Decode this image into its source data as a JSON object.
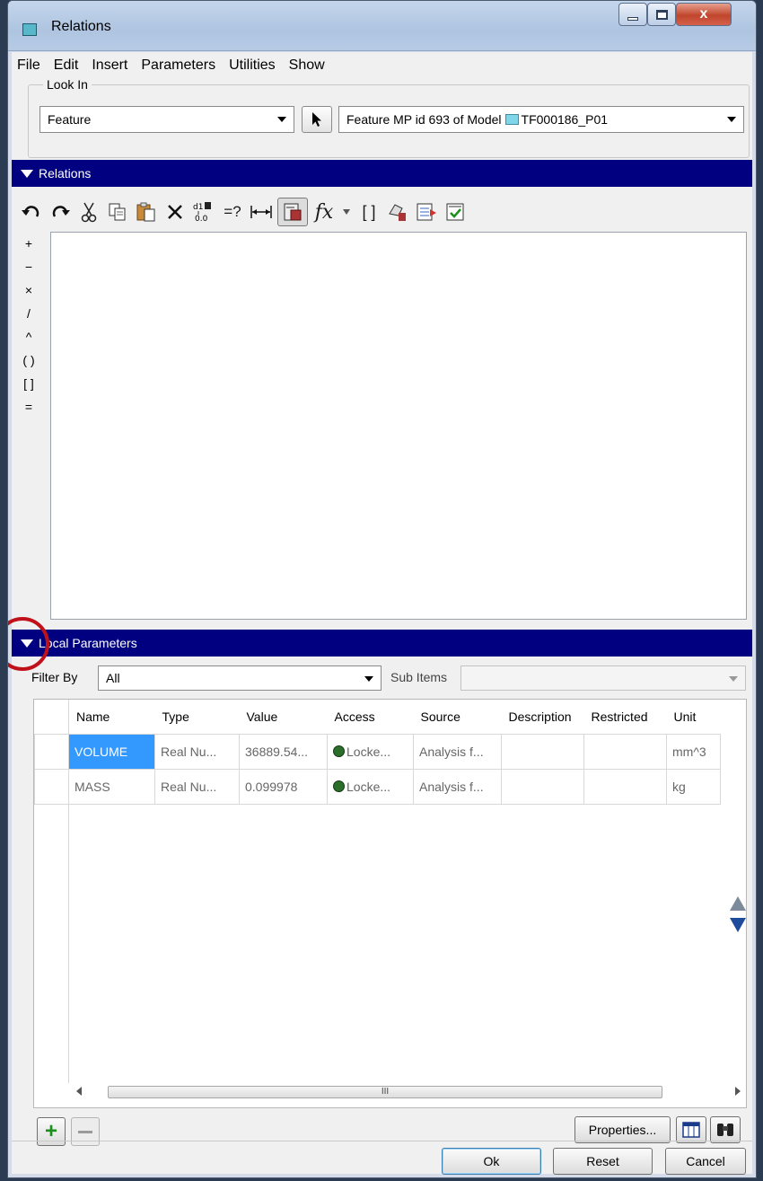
{
  "window": {
    "title": "Relations",
    "close_glyph": "x"
  },
  "menu": [
    "File",
    "Edit",
    "Insert",
    "Parameters",
    "Utilities",
    "Show"
  ],
  "look_in": {
    "legend": "Look In",
    "type_value": "Feature",
    "target_value": "Feature MP id 693 of Model",
    "model_name": "TF000186_P01"
  },
  "relations_section": {
    "title": "Relations"
  },
  "toolbar_icons": [
    "undo-icon",
    "redo-icon",
    "cut-icon",
    "copy-icon",
    "paste-icon",
    "delete-icon",
    "switch-dims-icon",
    "evaluate-icon",
    "insert-dimension-icon",
    "display-values-icon",
    "function-icon",
    "brackets-icon",
    "sort-icon",
    "verify-icon",
    "check-icon"
  ],
  "toolbar_text": {
    "fx": "fx",
    "evaluate": "=?",
    "brackets": "[ ]",
    "d1": "d1",
    "zero": "0.0"
  },
  "operators": [
    "+",
    "−",
    "×",
    "/",
    "^",
    "( )",
    "[ ]",
    "="
  ],
  "local_params_section": {
    "title": "Local Parameters"
  },
  "filter": {
    "label": "Filter By",
    "value": "All",
    "sub_items_label": "Sub Items",
    "sub_items_value": ""
  },
  "table": {
    "columns": [
      "Name",
      "Type",
      "Value",
      "Access",
      "Source",
      "Description",
      "Restricted",
      "Unit"
    ],
    "rows": [
      {
        "name": "VOLUME",
        "type": "Real Nu...",
        "value": "36889.54...",
        "access": "Locke...",
        "source": "Analysis f...",
        "description": "",
        "restricted": "",
        "unit": "mm^3"
      },
      {
        "name": "MASS",
        "type": "Real Nu...",
        "value": "0.099978",
        "access": "Locke...",
        "source": "Analysis f...",
        "description": "",
        "restricted": "",
        "unit": "kg"
      }
    ],
    "scroll_thumb_label": "III"
  },
  "buttons": {
    "properties": "Properties...",
    "ok": "Ok",
    "reset": "Reset",
    "cancel": "Cancel"
  },
  "colors": {
    "section_bar": "#000080",
    "selection": "#3399ff",
    "add_green": "#1b8f1b",
    "annotation_circle": "#c0101a"
  }
}
